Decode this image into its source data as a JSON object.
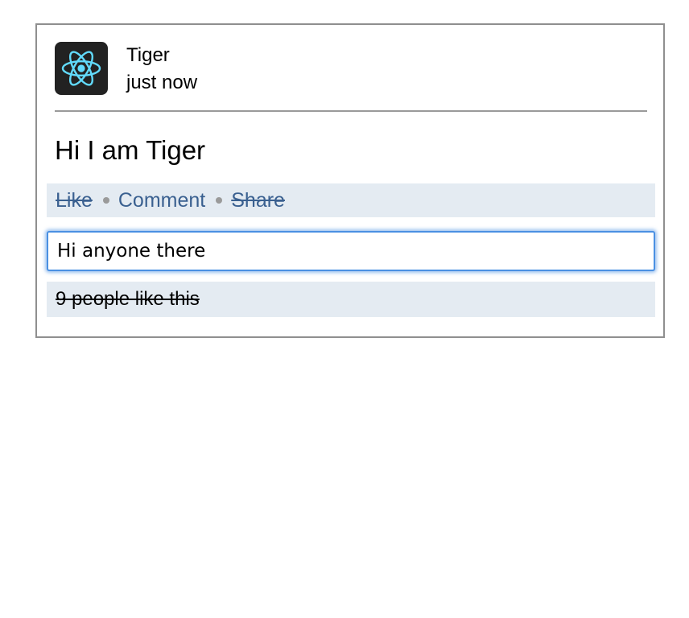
{
  "post": {
    "author": "Tiger",
    "timestamp": "just now",
    "text": "Hi I am Tiger",
    "avatar_icon": "react-atom-icon",
    "avatar_bg_color": "#222222",
    "avatar_icon_color": "#61dafb"
  },
  "actions": {
    "like_label": "Like",
    "comment_label": "Comment",
    "share_label": "Share",
    "link_color": "#3a6090",
    "bar_color": "#e4ebf2"
  },
  "comment_box": {
    "value": "Hi anyone there",
    "focus_color": "#4a90e2"
  },
  "likes_summary": {
    "text": "9 people like this"
  }
}
